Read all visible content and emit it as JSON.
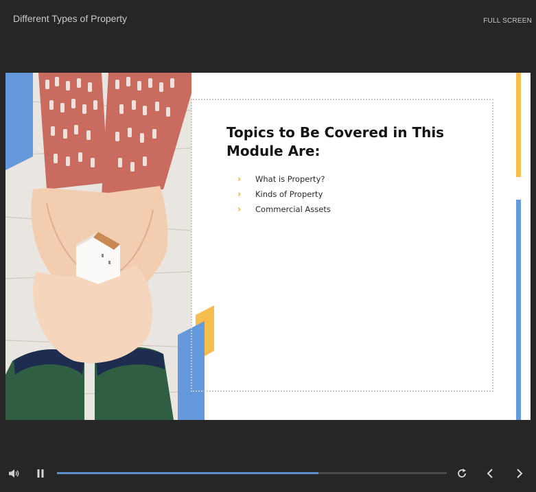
{
  "header": {
    "title": "Different Types of Property",
    "fullscreen_label": "FULL SCREEN"
  },
  "slide": {
    "heading": "Topics to Be Covered in This Module Are:",
    "topics": [
      "What is Property?",
      "Kinds of Property",
      "Commercial Assets"
    ],
    "colors": {
      "accent_yellow": "#f7bd4e",
      "accent_blue": "#6499dc",
      "bullet": "#f3b321"
    }
  },
  "player": {
    "progress": 0.67,
    "icons": {
      "volume": "volume-icon",
      "pause": "pause-icon",
      "replay": "replay-icon",
      "previous": "chevron-left-icon",
      "next": "chevron-right-icon"
    },
    "progress_color": "#5b8fcf"
  }
}
